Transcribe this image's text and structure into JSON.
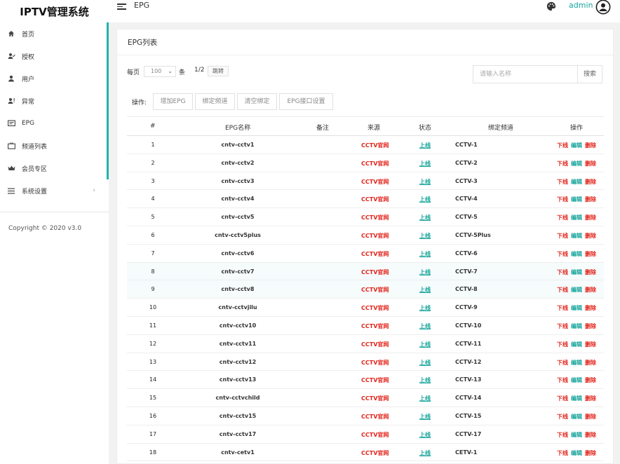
{
  "brand": "IPTV管理系统",
  "header": {
    "breadcrumb": "EPG",
    "admin_name": "admin"
  },
  "sidebar": {
    "items": [
      {
        "label": "首页",
        "icon": "home-icon"
      },
      {
        "label": "授权",
        "icon": "user-check-icon"
      },
      {
        "label": "用户",
        "icon": "user-icon"
      },
      {
        "label": "异常",
        "icon": "user-alert-icon"
      },
      {
        "label": "EPG",
        "icon": "epg-icon"
      },
      {
        "label": "频道列表",
        "icon": "tv-icon"
      },
      {
        "label": "会员专区",
        "icon": "crown-icon"
      },
      {
        "label": "系统设置",
        "icon": "menu-icon",
        "arrow": "›"
      }
    ],
    "copyright": "Copyright © 2020 v3.0"
  },
  "card": {
    "title": "EPG列表",
    "perpage_label": "每页",
    "perpage_value": "100",
    "perpage_unit": "条",
    "pager": "1/2",
    "jump_label": "跳转",
    "search_placeholder": "请输入名称",
    "search_button": "搜索",
    "ops_label": "操作:",
    "ops_buttons": [
      "增加EPG",
      "绑定频道",
      "清空绑定",
      "EPG接口设置"
    ]
  },
  "table": {
    "headers": [
      "#",
      "EPG名称",
      "备注",
      "来源",
      "状态",
      "绑定频道",
      "操作"
    ],
    "actions": [
      "下线",
      "编辑",
      "删除"
    ],
    "rows": [
      {
        "num": "1",
        "name": "cntv-cctv1",
        "source": "CCTV官网",
        "state": "上线",
        "channel": "CCTV-1"
      },
      {
        "num": "2",
        "name": "cntv-cctv2",
        "source": "CCTV官网",
        "state": "上线",
        "channel": "CCTV-2"
      },
      {
        "num": "3",
        "name": "cntv-cctv3",
        "source": "CCTV官网",
        "state": "上线",
        "channel": "CCTV-3"
      },
      {
        "num": "4",
        "name": "cntv-cctv4",
        "source": "CCTV官网",
        "state": "上线",
        "channel": "CCTV-4"
      },
      {
        "num": "5",
        "name": "cntv-cctv5",
        "source": "CCTV官网",
        "state": "上线",
        "channel": "CCTV-5"
      },
      {
        "num": "6",
        "name": "cntv-cctv5plus",
        "source": "CCTV官网",
        "state": "上线",
        "channel": "CCTV-5Plus"
      },
      {
        "num": "7",
        "name": "cntv-cctv6",
        "source": "CCTV官网",
        "state": "上线",
        "channel": "CCTV-6"
      },
      {
        "num": "8",
        "name": "cntv-cctv7",
        "source": "CCTV官网",
        "state": "上线",
        "channel": "CCTV-7"
      },
      {
        "num": "9",
        "name": "cntv-cctv8",
        "source": "CCTV官网",
        "state": "上线",
        "channel": "CCTV-8"
      },
      {
        "num": "10",
        "name": "cntv-cctvjilu",
        "source": "CCTV官网",
        "state": "上线",
        "channel": "CCTV-9"
      },
      {
        "num": "11",
        "name": "cntv-cctv10",
        "source": "CCTV官网",
        "state": "上线",
        "channel": "CCTV-10"
      },
      {
        "num": "12",
        "name": "cntv-cctv11",
        "source": "CCTV官网",
        "state": "上线",
        "channel": "CCTV-11"
      },
      {
        "num": "13",
        "name": "cntv-cctv12",
        "source": "CCTV官网",
        "state": "上线",
        "channel": "CCTV-12"
      },
      {
        "num": "14",
        "name": "cntv-cctv13",
        "source": "CCTV官网",
        "state": "上线",
        "channel": "CCTV-13"
      },
      {
        "num": "15",
        "name": "cntv-cctvchild",
        "source": "CCTV官网",
        "state": "上线",
        "channel": "CCTV-14"
      },
      {
        "num": "16",
        "name": "cntv-cctv15",
        "source": "CCTV官网",
        "state": "上线",
        "channel": "CCTV-15"
      },
      {
        "num": "17",
        "name": "cntv-cctv17",
        "source": "CCTV官网",
        "state": "上线",
        "channel": "CCTV-17"
      },
      {
        "num": "18",
        "name": "cntv-cetv1",
        "source": "CCTV官网",
        "state": "上线",
        "channel": "CETV-1"
      }
    ]
  }
}
